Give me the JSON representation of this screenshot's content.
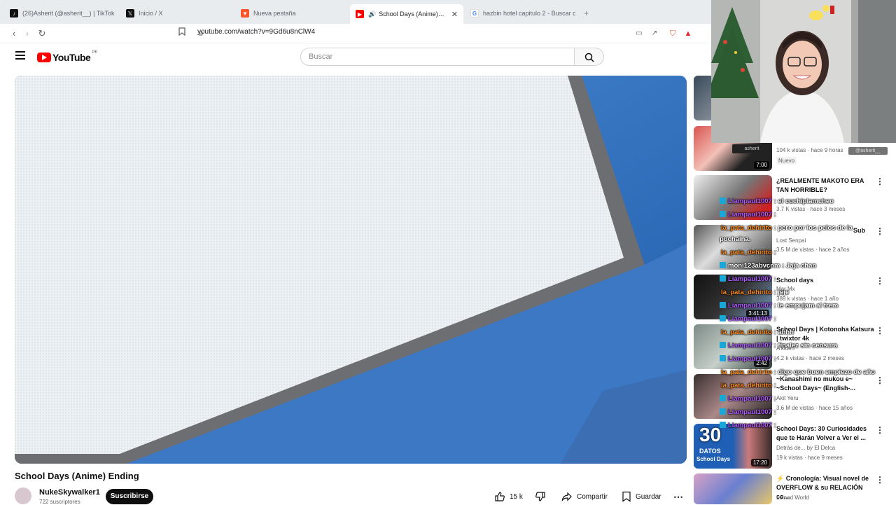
{
  "browser": {
    "tabs": [
      {
        "title": "(26)Asherit (@asherit__) | TikTok",
        "icon": "tiktok-icon"
      },
      {
        "title": "Inicio / X",
        "icon": "x-icon"
      },
      {
        "title": "Nueva pestaña",
        "icon": "brave-icon"
      },
      {
        "title": "School Days (Anime) Ending",
        "icon": "youtube-icon"
      },
      {
        "title": "hazbin hotel capitulo 2 - Buscar con",
        "icon": "google-icon"
      }
    ],
    "new_tab": "+",
    "url": "youtube.com/watch?v=9Gd6u8nClW4"
  },
  "youtube": {
    "logo": "YouTube",
    "region": "PE",
    "search_placeholder": "Buscar"
  },
  "video": {
    "title": "School Days (Anime) Ending",
    "channel": "NukeSkywalker1",
    "subscribers": "722 suscriptores",
    "subscribe_label": "Suscribirse",
    "likes": "15 k",
    "share_label": "Compartir",
    "save_label": "Guardar",
    "more": "⋯"
  },
  "recommendations": [
    {
      "title": "",
      "channel": "",
      "meta": "",
      "duration": ""
    },
    {
      "title": "",
      "channel": "",
      "meta": "104 k vistas · hace 9 horas",
      "duration": "7:00",
      "badge": "Nuevo"
    },
    {
      "title": "¿REALMENTE MAKOTO ERA TAN HORRIBLE?",
      "channel": "",
      "meta": "3.7 K vistas · hace 3 meses",
      "duration": ""
    },
    {
      "title": "",
      "channel": "Lost Senpai",
      "meta": "3.5 M de vistas · hace 2 años",
      "duration": "Sub"
    },
    {
      "title": "School days",
      "channel": "Mar Mx",
      "meta": "388 k vistas · hace 1 año",
      "duration": "3:41:13"
    },
    {
      "title": "School Days | Kotonoha Katsura | twixtor 4k",
      "channel": "A'kiden",
      "meta": "4.2 k vistas · hace 2 meses",
      "duration": "2:42"
    },
    {
      "title": "~Kanashimi no mukou e~ ~School Days~ (English-...",
      "channel": "Akit Yeru",
      "meta": "3.6 M de vistas · hace 15 años",
      "duration": ""
    },
    {
      "title": "School Days: 30 Curiosidades que te Harán Volver a Ver el ...",
      "channel": "Detrás de... by El Delca",
      "meta": "19 k vistas · hace 9 meses",
      "duration": "17:20",
      "thumb_text": "30",
      "thumb_sub": "DATOS",
      "thumb_sub2": "School Days"
    },
    {
      "title": "⚡ Cronología: Visual novel de OVERFLOW & su RELACIÓN co...",
      "channel": "Leinad World",
      "meta": "",
      "duration": ""
    }
  ],
  "webcam": {
    "overlay_name": "@asherit__",
    "small_label": "asherit"
  },
  "chat": [
    {
      "user": "Liampaul1007",
      "text": ": el cuchiplamcheo",
      "color": "#b05cff"
    },
    {
      "user": "Liampaul1007",
      "text": ":",
      "color": "#b05cff"
    },
    {
      "user": "la_pata_dehirito",
      "text": ": pero por los pelos de la",
      "color": "#ff8c1a"
    },
    {
      "user": "",
      "text": "puchaina.",
      "color": "#ffffff"
    },
    {
      "user": "la_pata_dehirito",
      "text": ":",
      "color": "#ff8c1a"
    },
    {
      "user": "moni123abvcnm",
      "text": ": Jaja chan",
      "color": "#ffffff"
    },
    {
      "user": "Liampaul1007",
      "text": ":",
      "color": "#b05cff"
    },
    {
      "user": "la_pata_dehirito",
      "text": ": jeje",
      "color": "#ff8c1a"
    },
    {
      "user": "Liampaul1007",
      "text": ": le empujam al trem",
      "color": "#b05cff"
    },
    {
      "user": "Liampaul1007",
      "text": ":",
      "color": "#b05cff"
    },
    {
      "user": "la_pata_dehirito",
      "text": ": ahhh",
      "color": "#ff8c1a"
    },
    {
      "user": "Liampaul1007",
      "text": ": finalez sin censura",
      "color": "#b05cff"
    },
    {
      "user": "Liampaul1007",
      "text": ":",
      "color": "#b05cff"
    },
    {
      "user": "la_pata_dehirito",
      "text": ": digo que buen empiezo de año",
      "color": "#ff8c1a"
    },
    {
      "user": "la_pata_dehirito",
      "text": ":",
      "color": "#ff8c1a"
    },
    {
      "user": "Liampaul1007",
      "text": ":",
      "color": "#b05cff"
    },
    {
      "user": "Liampaul1007",
      "text": ":",
      "color": "#b05cff"
    },
    {
      "user": "Liampaul1007",
      "text": ":",
      "color": "#b05cff"
    }
  ],
  "colors": {
    "youtube_red": "#ff0000",
    "video_blue": "#2f6fbf",
    "chat_purple": "#b05cff",
    "chat_orange": "#ff8c1a"
  }
}
